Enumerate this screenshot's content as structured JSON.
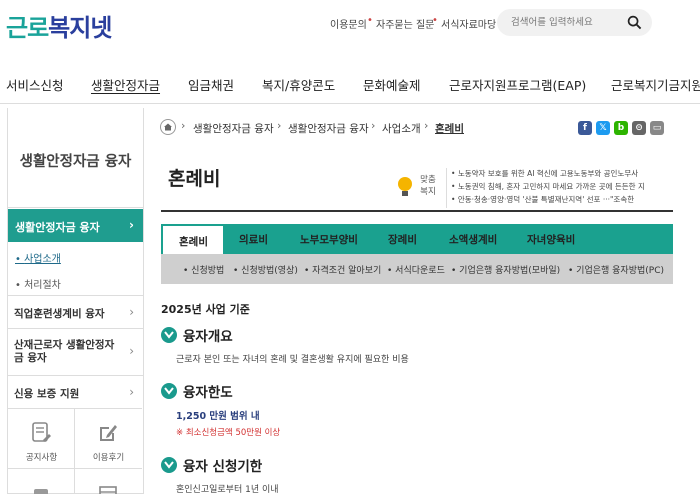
{
  "logo": {
    "part1": "근로",
    "part2": "복지넷"
  },
  "utility": [
    "이용문의",
    "자주묻는 질문",
    "서식자료마당"
  ],
  "search": {
    "placeholder": "검색어를 입력하세요"
  },
  "gnb": [
    "서비스신청",
    "생활안정자금",
    "임금채권",
    "복지/휴양콘도",
    "문화예술제",
    "근로자지원프로그램(EAP)",
    "근로복지기금지원"
  ],
  "sidebar": {
    "title": "생활안정자금 융자",
    "active": "생활안정자금 융자",
    "subs": [
      "사업소개",
      "처리절차"
    ],
    "menus": [
      "직업훈련생계비 융자",
      "산재근로자 생활안정자금 융자",
      "신용 보증 지원"
    ],
    "quick": [
      "공지사항",
      "이용후기"
    ]
  },
  "breadcrumb": [
    "생활안정자금 융자",
    "생활안정자금 융자",
    "사업소개",
    "혼례비"
  ],
  "page_title": "혼례비",
  "notice": {
    "label": "맞춤복지",
    "lines": [
      "노동약자 보호를 위한 AI 혁신에 고용노동부와 공인노무사",
      "노동권익 침해, 혼자 고민하지 마세요 가까운 곳에 든든한 지",
      "안동·청송·영양·영덕 '산불 특별재난지역' 선포 ···\"조속한"
    ]
  },
  "tabs": [
    "혼례비",
    "의료비",
    "노부모부양비",
    "장례비",
    "소액생계비",
    "자녀양육비"
  ],
  "subtabs": [
    "신청방법",
    "신청방법(영상)",
    "자격조건 알아보기",
    "서식다운로드",
    "기업은행 융자방법(모바일)",
    "기업은행 융자방법(PC)"
  ],
  "year": "2025년 사업 기준",
  "sections": {
    "s1": {
      "title": "융자개요",
      "text": "근로자 본인 또는 자녀의 혼례 및 결혼생활 유지에 필요한 비용"
    },
    "s2": {
      "title": "융자한도",
      "amount": "1,250 만원 범위 내",
      "warn": "※ 최소신청금액 50만원 이상"
    },
    "s3": {
      "title": "융자 신청기한",
      "text": "혼인신고일로부터 1년 이내"
    }
  },
  "colors": {
    "accent": "#1aa18f",
    "brand_blue": "#2a3f9d",
    "warn": "#d23030"
  }
}
